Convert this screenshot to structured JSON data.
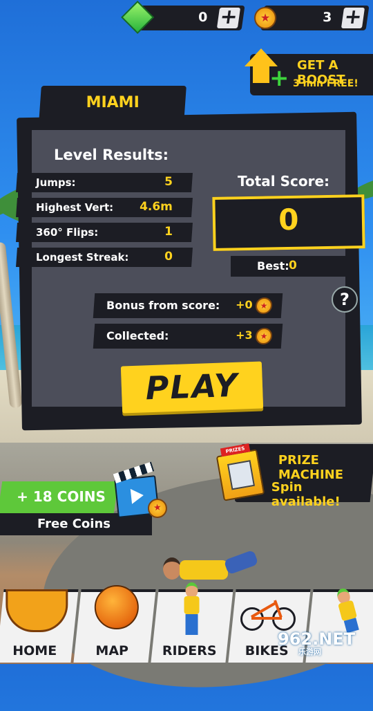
{
  "top_bar": {
    "gems": "0",
    "coins": "3",
    "plus_symbol": "+"
  },
  "boost": {
    "title": "GET A BOOST",
    "subtitle": "3 min FREE!"
  },
  "results": {
    "location": "MIAMI",
    "heading": "Level Results:",
    "rows": [
      {
        "label": "Jumps:",
        "value": "5"
      },
      {
        "label": "Highest Vert:",
        "value": "4.6m"
      },
      {
        "label": "360° Flips:",
        "value": "1"
      },
      {
        "label": "Longest Streak:",
        "value": "0"
      }
    ],
    "total_score_label": "Total Score:",
    "total_score": "0",
    "best_label": "Best:",
    "best_value": "0",
    "help_symbol": "?",
    "bonus_label": "Bonus from score:",
    "bonus_value": "+0",
    "collected_label": "Collected:",
    "collected_value": "+3",
    "coin_symbol": "★"
  },
  "play_button": "PLAY",
  "prize_machine": {
    "title": "PRIZE MACHINE",
    "subtitle": "Spin available!",
    "sign": "PRIZES"
  },
  "free_coins": {
    "amount": "+ 18 COINS",
    "label": "Free Coins"
  },
  "bottom_nav": [
    {
      "label": "HOME"
    },
    {
      "label": "MAP"
    },
    {
      "label": "RIDERS"
    },
    {
      "label": "BIKES"
    }
  ],
  "watermark": {
    "main": "962.NET",
    "sub": "乐游网"
  },
  "colors": {
    "accent": "#ffd21e",
    "panel": "#1c1d24",
    "inner": "#4c4e5a",
    "green": "#5ec83a"
  }
}
